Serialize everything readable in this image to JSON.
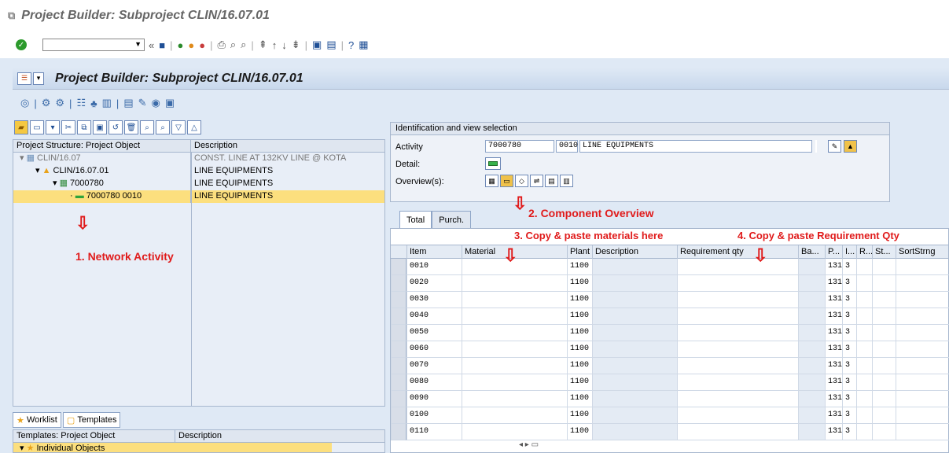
{
  "window": {
    "title": "Project Builder: Subproject CLIN/16.07.01"
  },
  "app": {
    "title": "Project Builder: Subproject CLIN/16.07.01"
  },
  "tree": {
    "headers": [
      "Project Structure: Project Object",
      "Description"
    ],
    "rows": [
      {
        "label": "CLIN/16.07",
        "desc": "CONST. LINE AT 132KV LINE @ KOTA",
        "indent": 0,
        "icon": "project-icon"
      },
      {
        "label": "CLIN/16.07.01",
        "desc": "LINE EQUIPMENTS",
        "indent": 1,
        "icon": "wbs-element-icon"
      },
      {
        "label": "7000780",
        "desc": "LINE EQUIPMENTS",
        "indent": 2,
        "icon": "network-icon"
      },
      {
        "label": "7000780 0010",
        "desc": "LINE EQUIPMENTS",
        "indent": 3,
        "icon": "activity-icon"
      }
    ]
  },
  "bottom_tabs": {
    "worklist": "Worklist",
    "templates": "Templates"
  },
  "templates": {
    "headers": [
      "Templates: Project Object",
      "Description"
    ],
    "row": "Individual Objects"
  },
  "ident": {
    "title": "Identification and view selection",
    "activity_label": "Activity",
    "network": "7000780",
    "op": "0010",
    "text": "LINE EQUIPMENTS",
    "detail_label": "Detail:",
    "overview_label": "Overview(s):"
  },
  "tabs": [
    "Total",
    "Purch."
  ],
  "grid": {
    "headers": [
      "Item",
      "Material",
      "Plant",
      "Description",
      "Requirement qty",
      "Ba...",
      "P...",
      "I...",
      "R...",
      "St...",
      "SortStrng"
    ],
    "rows": [
      {
        "item": "0010",
        "plant": "1100",
        "p": "131",
        "r": "3"
      },
      {
        "item": "0020",
        "plant": "1100",
        "p": "131",
        "r": "3"
      },
      {
        "item": "0030",
        "plant": "1100",
        "p": "131",
        "r": "3"
      },
      {
        "item": "0040",
        "plant": "1100",
        "p": "131",
        "r": "3"
      },
      {
        "item": "0050",
        "plant": "1100",
        "p": "131",
        "r": "3"
      },
      {
        "item": "0060",
        "plant": "1100",
        "p": "131",
        "r": "3"
      },
      {
        "item": "0070",
        "plant": "1100",
        "p": "131",
        "r": "3"
      },
      {
        "item": "0080",
        "plant": "1100",
        "p": "131",
        "r": "3"
      },
      {
        "item": "0090",
        "plant": "1100",
        "p": "131",
        "r": "3"
      },
      {
        "item": "0100",
        "plant": "1100",
        "p": "131",
        "r": "3"
      },
      {
        "item": "0110",
        "plant": "1100",
        "p": "131",
        "r": "3"
      }
    ]
  },
  "annotations": {
    "a1": "1. Network Activity",
    "a2": "2. Component Overview",
    "a3": "3. Copy & paste materials here",
    "a4": "4. Copy & paste Requirement Qty"
  },
  "colors": {
    "annotation": "#e01b1b",
    "selection": "#fcdf7e",
    "frame": "#dfe9f5"
  }
}
